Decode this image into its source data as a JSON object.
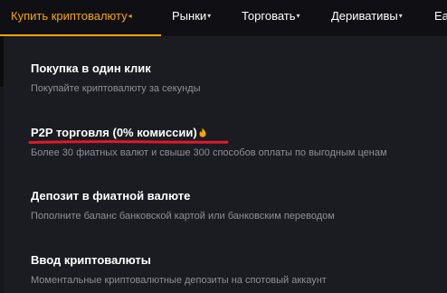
{
  "nav": {
    "items": [
      {
        "label": "Купить криптовалюту",
        "caret": "◂",
        "active": true
      },
      {
        "label": "Рынки",
        "caret": "▾"
      },
      {
        "label": "Торговать",
        "caret": "▾"
      },
      {
        "label": "Деривативы",
        "caret": "▾"
      },
      {
        "label": "Ea"
      }
    ],
    "accent_color": "#f7a600"
  },
  "menu": {
    "items": [
      {
        "title": "Покупка в один клик",
        "desc": "Покупайте криптовалюту за секунды"
      },
      {
        "title": "P2P торговля (0% комиссии)",
        "desc": "Более 30 фиатных валют и свыше 300 способов оплаты по выгодным ценам",
        "badge_icon": "fire-icon",
        "highlight_color": "#e0192b"
      },
      {
        "title": "Депозит в фиатной валюте",
        "desc": "Пополните баланс банковской картой или банковским переводом"
      },
      {
        "title": "Ввод криптовалюты",
        "desc": "Моментальные криптовалютные депозиты на спотовый аккаунт"
      }
    ]
  }
}
